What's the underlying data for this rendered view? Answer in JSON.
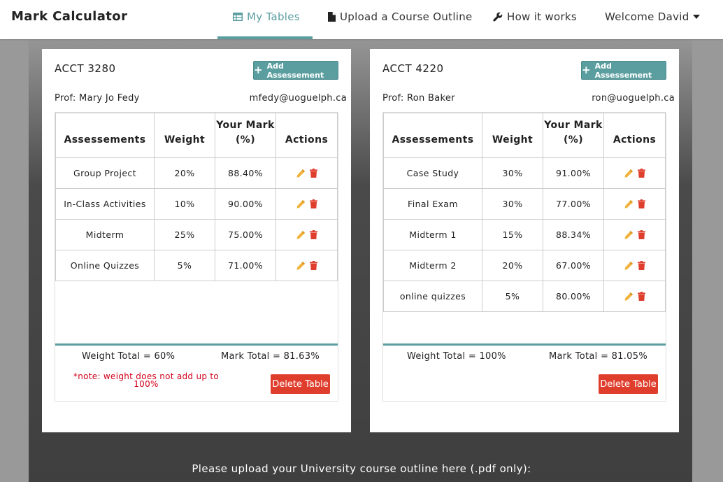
{
  "navbar": {
    "brand": "Mark Calculator",
    "items": [
      {
        "label": "My Tables",
        "icon": "table-icon"
      },
      {
        "label": "Upload a Course Outline",
        "icon": "file-icon"
      },
      {
        "label": "How it works",
        "icon": "wrench-icon"
      }
    ],
    "user_menu": "Welcome David",
    "accent": "#5b9ea0"
  },
  "tables": [
    {
      "course": "ACCT 3280",
      "add_label": "Add Assessement",
      "prof": "Prof: Mary Jo Fedy",
      "email": "mfedy@uoguelph.ca",
      "headers": [
        "Assessements",
        "Weight",
        "Your Mark (%)",
        "Actions"
      ],
      "rows": [
        {
          "name": "Group Project",
          "weight": "20%",
          "mark": "88.40%"
        },
        {
          "name": "In-Class Activities",
          "weight": "10%",
          "mark": "90.00%"
        },
        {
          "name": "Midterm",
          "weight": "25%",
          "mark": "75.00%"
        },
        {
          "name": "Online Quizzes",
          "weight": "5%",
          "mark": "71.00%"
        }
      ],
      "weight_total": "Weight Total = 60%",
      "mark_total": "Mark Total = 81.63%",
      "note": "*note: weight does not add up to 100%",
      "delete_label": "Delete Table"
    },
    {
      "course": "ACCT 4220",
      "add_label": "Add Assessement",
      "prof": "Prof: Ron Baker",
      "email": "ron@uoguelph.ca",
      "headers": [
        "Assessements",
        "Weight",
        "Your Mark (%)",
        "Actions"
      ],
      "rows": [
        {
          "name": "Case Study",
          "weight": "30%",
          "mark": "91.00%"
        },
        {
          "name": "Final Exam",
          "weight": "30%",
          "mark": "77.00%"
        },
        {
          "name": "Midterm 1",
          "weight": "15%",
          "mark": "88.34%"
        },
        {
          "name": "Midterm 2",
          "weight": "20%",
          "mark": "67.00%"
        },
        {
          "name": "online quizzes",
          "weight": "5%",
          "mark": "80.00%"
        }
      ],
      "weight_total": "Weight Total = 100%",
      "mark_total": "Mark Total = 81.05%",
      "note": "",
      "delete_label": "Delete Table"
    }
  ],
  "upload_prompt": "Please upload your University course outline here (.pdf only):"
}
